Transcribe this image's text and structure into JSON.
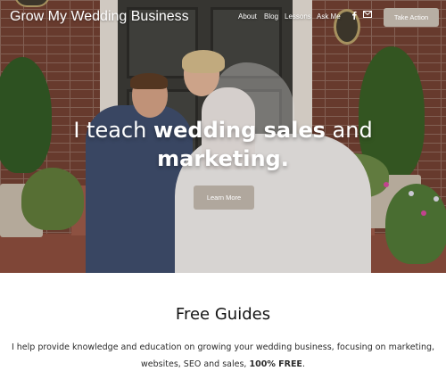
{
  "header": {
    "brand": "Grow My Wedding Business",
    "nav": [
      {
        "label": "About"
      },
      {
        "label": "Blog"
      },
      {
        "label": "Lessons"
      },
      {
        "label": "Ask Me"
      }
    ],
    "icons": [
      "facebook-icon",
      "mail-icon"
    ],
    "cta_label": "Take Action"
  },
  "hero": {
    "headline_line1_prefix": "I teach ",
    "headline_line1_bold": "wedding sales",
    "headline_line1_suffix": " and",
    "headline_line2_bold": "marketing.",
    "button_label": "Learn More"
  },
  "guides": {
    "title": "Free Guides",
    "description_part1": "I help provide knowledge and education on growing your wedding business, focusing on marketing,",
    "description_part2": "websites, SEO and sales, ",
    "description_bold": "100% FREE",
    "description_end": "."
  },
  "colors": {
    "button_bg": "#b7aea3",
    "heading_text": "#141414"
  }
}
